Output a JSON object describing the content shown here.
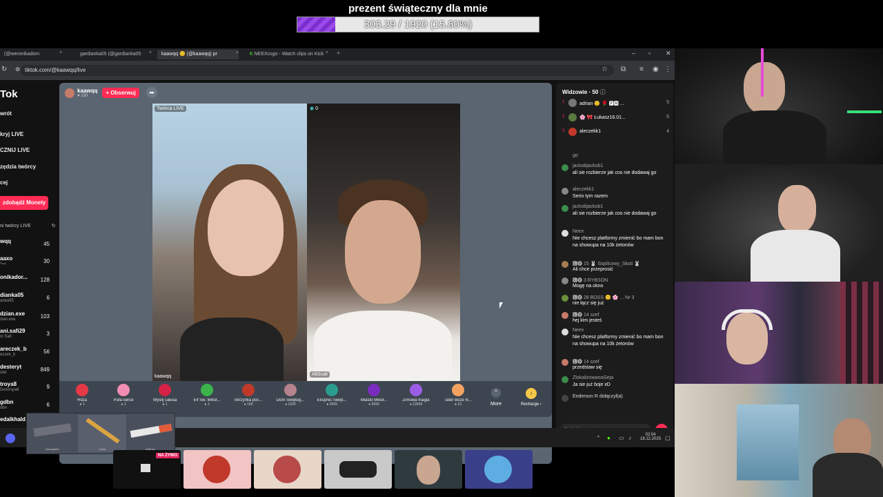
{
  "goal": {
    "title": "prezent świąteczny dla mnie",
    "progress_text": "303.29 / 1920 (15.80%)",
    "progress_fraction": 0.158
  },
  "browser": {
    "tabs": [
      {
        "label": "(@weronikadom",
        "active": false
      },
      {
        "label": "gardianka05 (@gardianka05",
        "active": false
      },
      {
        "label": "kaawqq 😊 (@kaawqq) pr",
        "active": true
      },
      {
        "label": "NEEXcsgo - Watch clips on Kick",
        "active": false
      }
    ],
    "new_tab": "+",
    "url": "tiktok.com/@kaawqq/live"
  },
  "tiktok": {
    "logo": "Tok",
    "nav": [
      "wrót",
      "kryj LIVE",
      "CZNIJ LIVE",
      "zędzia twórcy",
      "cej"
    ],
    "coins_button": "zdobądź Monety",
    "creators_title": "ni twórcy LIVE",
    "creators": [
      {
        "name": "wqq",
        "sub": "",
        "count": "45"
      },
      {
        "name": "aaxo",
        "sub": "*≈<",
        "count": "30"
      },
      {
        "name": "onikador...",
        "sub": "",
        "count": "128"
      },
      {
        "name": "dianka05",
        "sub": "anka05",
        "count": "6"
      },
      {
        "name": "dzian.exe",
        "sub": "zian.exe",
        "count": "103"
      },
      {
        "name": "ani.safi29",
        "sub": "ni Safi",
        "count": "3"
      },
      {
        "name": "areczek_b",
        "sub": "eczek_b",
        "count": "56"
      },
      {
        "name": "desteryt",
        "sub": "ster",
        "count": "849"
      },
      {
        "name": "troya8",
        "sub": "Destroya8",
        "count": "9"
      },
      {
        "name": "gdbn",
        "sub": "dbn",
        "count": "6"
      },
      {
        "name": "edalkhald",
        "sub": "",
        "count": ""
      }
    ]
  },
  "live": {
    "host_name": "kaawqq",
    "host_likes": "♥ 150",
    "follow_label": "+ Obserwuj",
    "creator_tag": "Twórca LIVE",
    "viewer_pill": "0",
    "left_name": "kaawqq",
    "right_name": "AliScali"
  },
  "gifts": [
    {
      "name": "Róża",
      "price": "1",
      "color": "#e63946"
    },
    {
      "name": "Pufa-serce",
      "price": "1",
      "color": "#f28db2"
    },
    {
      "name": "Wyślij całusa",
      "price": "1",
      "color": "#d62246"
    },
    {
      "name": "Elf Św. Mikoł...",
      "price": "1",
      "color": "#3cb44b"
    },
    {
      "name": "Skrzynka poc...",
      "price": "199",
      "color": "#c0392b"
    },
    {
      "name": "Dom Święteg...",
      "price": "2200",
      "color": "#b5838d"
    },
    {
      "name": "Ekspres Święt...",
      "price": "5999",
      "color": "#2a9d8f"
    },
    {
      "name": "Miasto Mikoł...",
      "price": "9999",
      "color": "#7b2cbf"
    },
    {
      "name": "Zimowa magia",
      "price": "19999",
      "color": "#9b5de5"
    },
    {
      "name": "Tater Boże N...",
      "price": "10",
      "color": "#f4a261"
    }
  ],
  "more_label": "More",
  "recharge_label": "Recharge ›",
  "chat": {
    "viewers_title": "Widzowie · 50",
    "top_viewers": [
      {
        "rank": "1",
        "name": "adrian 😊 🌹 🅿🅼 ...",
        "count": "5"
      },
      {
        "rank": "2",
        "name": "🌸 🎀 Łukasz16.01...",
        "count": "5"
      },
      {
        "rank": "3",
        "name": "aleczekk1",
        "count": "4"
      }
    ],
    "messages": [
      {
        "user": "go",
        "body": "",
        "avatar": "#1c1c1c"
      },
      {
        "user": "jackobjackob1",
        "body": "ali sie rozbierze jak cos nie dodawaj go",
        "avatar": "#3a8d4a"
      },
      {
        "user": "aleczekk1",
        "body": "Serio tym razem",
        "avatar": "#888888"
      },
      {
        "user": "jackobjackob1",
        "body": "ali sie rozbierze jak cos nie dodawaj go",
        "avatar": "#3a8d4a"
      },
      {
        "user": "Neex",
        "body": "Nie chcesz platformy zmienić bo mam bon na showupa na 10k żetonów",
        "avatar": "#dddddd"
      },
      {
        "user": "🅻🅥 15 🐰 Sopilcowy_Skoti 🐰",
        "body": "Ali chce przeprosić",
        "avatar": "#a67c52"
      },
      {
        "user": "🅻🅥 3 RYBSON",
        "body": "Mogę na okno",
        "avatar": "#888888"
      },
      {
        "user": "🅻🅥 28 BOSS 😊 🌸 ... Nr 3",
        "body": "nie łącz się już",
        "avatar": "#6a8f3a"
      },
      {
        "user": "🅻🅥 14 szef",
        "body": "hej kim jesteś",
        "avatar": "#c97a6a"
      },
      {
        "user": "Neex",
        "body": "Nie chcesz platformy zmienić bo mam bon na showupa na 10k żetonów",
        "avatar": "#dddddd"
      },
      {
        "user": "🅻🅥 14 szef",
        "body": "przedstaw się",
        "avatar": "#c97a6a"
      },
      {
        "user": "ZlokalizowanoGeja",
        "body": "Ja sie już boje xD",
        "avatar": "#3a8d4a"
      },
      {
        "user": "Enderson R dołączył(a)",
        "body": "",
        "avatar": "#444444"
      }
    ],
    "input_placeholder": "Dodaj komentarz..."
  },
  "taskbar": {
    "time": "02:04",
    "date": "18.12.2025"
  },
  "bottom": {
    "live_badge": "NA ŻYWO"
  },
  "weapons": [
    {
      "label": "Navegador"
    },
    {
      "label": "Lotus"
    },
    {
      "label": "Asiimov"
    }
  ]
}
